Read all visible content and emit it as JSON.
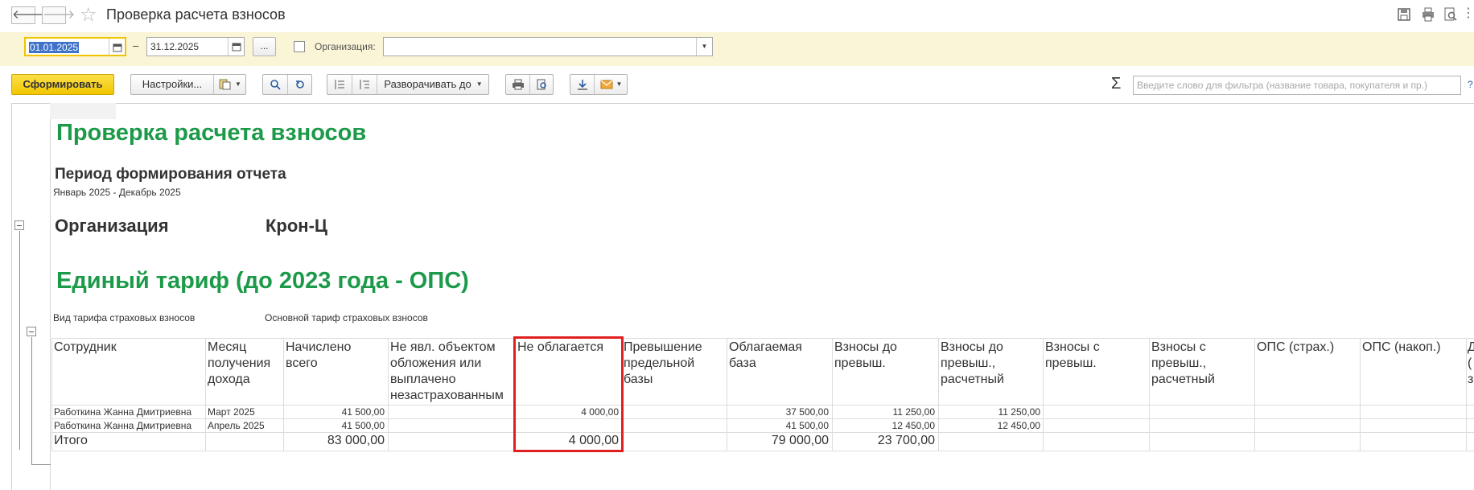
{
  "window": {
    "title": "Проверка расчета взносов",
    "back_icon": "arrow-left-icon",
    "forward_icon": "arrow-right-icon",
    "favorite_icon": "star-icon",
    "right_icons": [
      "save-icon",
      "print-icon",
      "preview-icon",
      "more-icon"
    ]
  },
  "filters": {
    "date_from": "01.01.2025",
    "dash": "–",
    "date_to": "31.12.2025",
    "period_button": "...",
    "org_label": "Организация:",
    "org_value": ""
  },
  "toolbar": {
    "generate": "Сформировать",
    "settings": "Настройки...",
    "expand": "Разворачивать до",
    "sum_icon": "Σ",
    "filter_placeholder": "Введите слово для фильтра (название товара, покупателя и пр.)",
    "help": "?"
  },
  "report": {
    "title": "Проверка расчета взносов",
    "period_label": "Период формирования отчета",
    "period_value": "Январь 2025 - Декабрь 2025",
    "org_label": "Организация",
    "org_value": "Крон-Ц",
    "tariff_heading": "Единый тариф (до 2023 года - ОПС)",
    "tariff_type_label": "Вид тарифа страховых взносов",
    "tariff_type_value": "Основной тариф страховых взносов",
    "columns": [
      "Сотрудник",
      "Месяц получения дохода",
      "Начислено всего",
      "Не явл. объектом обложения или выплачено незастрахованным",
      "Не облагается",
      "Превышение предельной базы",
      "Облагаемая база",
      "Взносы до превыш.",
      "Взносы до превыш., расчетный",
      "Взносы с превыш.",
      "Взносы с превыш., расчетный",
      "ОПС (страх.)",
      "ОПС (накоп.)",
      "Д ( з"
    ],
    "rows": [
      {
        "employee": "Работкина Жанна Дмитриевна",
        "month": "Март 2025",
        "accrued": "41 500,00",
        "not_object": "",
        "not_taxed": "4 000,00",
        "excess": "",
        "base": "37 500,00",
        "before": "11 250,00",
        "before_calc": "11 250,00",
        "after": "",
        "after_calc": ""
      },
      {
        "employee": "Работкина Жанна Дмитриевна",
        "month": "Апрель 2025",
        "accrued": "41 500,00",
        "not_object": "",
        "not_taxed": "",
        "excess": "",
        "base": "41 500,00",
        "before": "12 450,00",
        "before_calc": "12 450,00",
        "after": "",
        "after_calc": ""
      }
    ],
    "total": {
      "label": "Итого",
      "accrued": "83 000,00",
      "not_taxed": "4 000,00",
      "base": "79 000,00",
      "before": "23 700,00"
    }
  }
}
